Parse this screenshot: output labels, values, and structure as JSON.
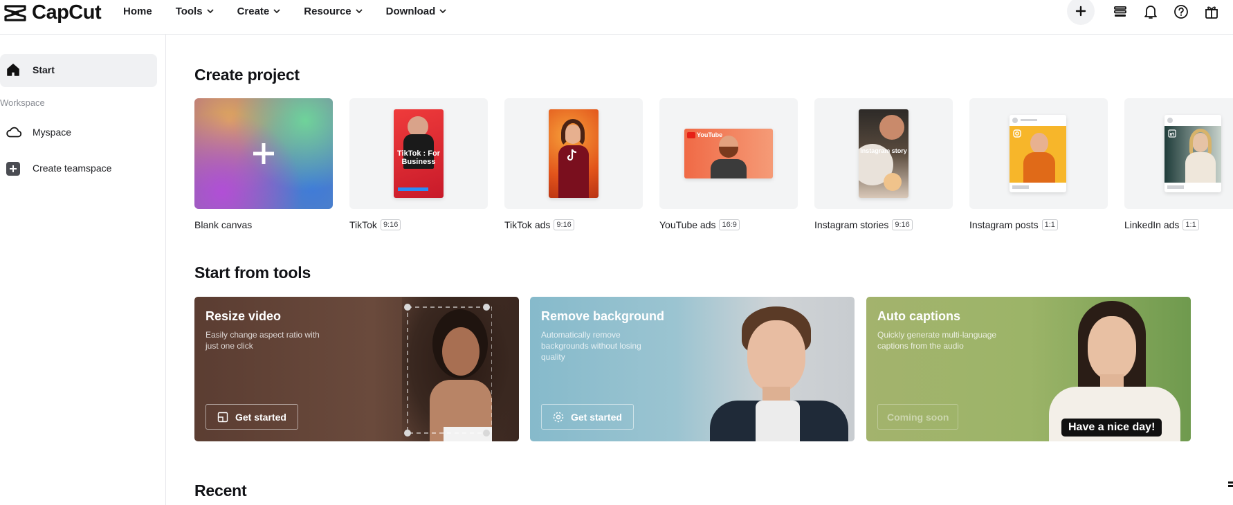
{
  "brand": {
    "name": "CapCut"
  },
  "nav": [
    {
      "label": "Home",
      "has_menu": false
    },
    {
      "label": "Tools",
      "has_menu": true
    },
    {
      "label": "Create",
      "has_menu": true
    },
    {
      "label": "Resource",
      "has_menu": true
    },
    {
      "label": "Download",
      "has_menu": true
    }
  ],
  "top_icons": [
    "plus-icon",
    "layers-icon",
    "bell-icon",
    "help-icon",
    "gift-icon"
  ],
  "sidebar": {
    "start_label": "Start",
    "section_label": "Workspace",
    "items": [
      {
        "label": "Myspace",
        "icon": "cloud-icon"
      },
      {
        "label": "Create teamspace",
        "icon": "plus-square-icon"
      }
    ]
  },
  "create_project": {
    "title": "Create project",
    "cards": [
      {
        "label": "Blank canvas",
        "ratio": ""
      },
      {
        "label": "TikTok",
        "ratio": "9:16",
        "thumb_text": "TikTok : For Business"
      },
      {
        "label": "TikTok ads",
        "ratio": "9:16"
      },
      {
        "label": "YouTube ads",
        "ratio": "16:9",
        "thumb_text": "YouTube"
      },
      {
        "label": "Instagram stories",
        "ratio": "9:16",
        "thumb_text": "Instagram story"
      },
      {
        "label": "Instagram posts",
        "ratio": "1:1"
      },
      {
        "label": "LinkedIn ads",
        "ratio": "1:1"
      }
    ]
  },
  "tools": {
    "title": "Start from tools",
    "cards": [
      {
        "title": "Resize video",
        "desc": "Easily change aspect ratio with just one click",
        "button": "Get started",
        "bg": "#5d3f33"
      },
      {
        "title": "Remove background",
        "desc": "Automatically remove backgrounds without losing quality",
        "button": "Get started",
        "bg": "#8dbfcf"
      },
      {
        "title": "Auto captions",
        "desc": "Quickly generate multi-language captions from the audio",
        "button": "Coming soon",
        "bg": "#97b065",
        "caption_overlay": "Have a nice day!"
      }
    ]
  },
  "recent": {
    "title": "Recent"
  }
}
